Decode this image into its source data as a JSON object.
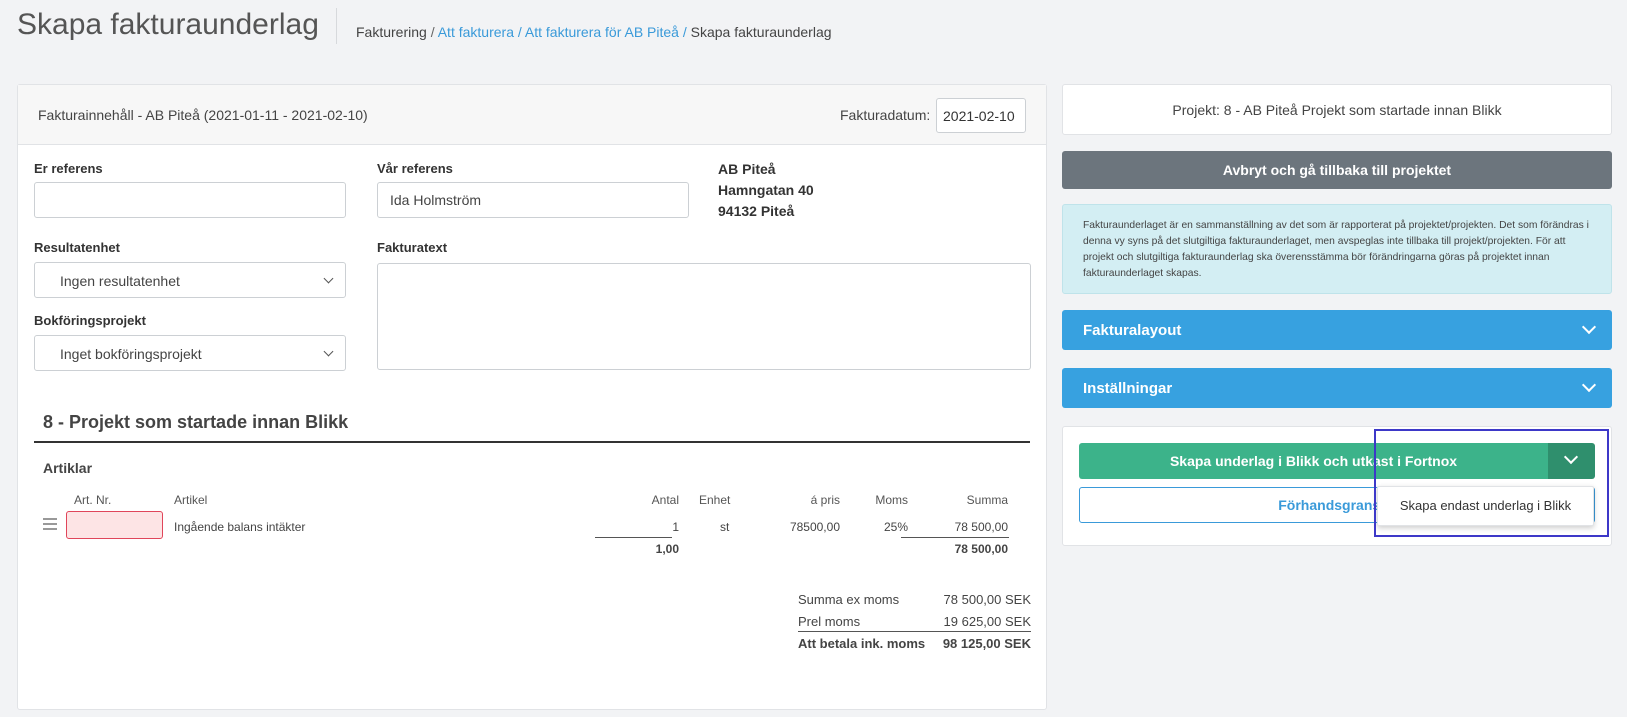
{
  "header": {
    "title": "Skapa fakturaunderlag",
    "breadcrumb": [
      "Fakturering",
      "Att fakturera",
      "Att fakturera för AB Piteå",
      "Skapa fakturaunderlag"
    ],
    "separator": "/"
  },
  "invoice": {
    "content_title": "Fakturainnehåll - AB Piteå (2021-01-11 - 2021-02-10)",
    "date_label": "Fakturadatum:",
    "date_value": "2021-02-10"
  },
  "form": {
    "our_reference_label": "Er referens",
    "our_reference_value": "",
    "your_reference_label": "Vår referens",
    "your_reference_value": "Ida Holmström",
    "result_unit_label": "Resultatenhet",
    "result_unit_value": "Ingen resultatenhet",
    "booking_project_label": "Bokföringsprojekt",
    "booking_project_value": "Inget bokföringsprojekt",
    "invoice_text_label": "Fakturatext",
    "invoice_text_value": ""
  },
  "customer": {
    "name": "AB Piteå",
    "street": "Hamngatan 40",
    "city": "94132 Piteå"
  },
  "project": {
    "title": "8 - Projekt som startade innan Blikk",
    "articles_title": "Artiklar",
    "columns": {
      "art_nr": "Art. Nr.",
      "article": "Artikel",
      "quantity": "Antal",
      "unit": "Enhet",
      "price": "á pris",
      "vat": "Moms",
      "sum": "Summa"
    },
    "rows": [
      {
        "art_nr": "",
        "article": "Ingående balans intäkter",
        "quantity": "1",
        "unit": "st",
        "price": "78500,00",
        "vat": "25%",
        "sum": "78 500,00"
      }
    ],
    "totals_row": {
      "quantity": "1,00",
      "sum": "78 500,00"
    }
  },
  "totals": {
    "ex_vat_label": "Summa ex moms",
    "ex_vat_value": "78 500,00 SEK",
    "vat_label": "Prel moms",
    "vat_value": "19 625,00 SEK",
    "total_label": "Att betala ink. moms",
    "total_value": "98 125,00 SEK"
  },
  "sidebar": {
    "project_label": "Projekt: 8 - AB Piteå Projekt som startade innan Blikk",
    "cancel_button": "Avbryt och gå tillbaka till projektet",
    "info_text": "Fakturaunderlaget är en sammanställning av det som är rapporterat på projektet/projekten. Det som förändras i denna vy syns på det slutgiltiga fakturaunderlaget, men avspeglas inte tillbaka till projekt/projekten. För att projekt och slutgiltiga fakturaunderlag ska överensstämma bör förändringarna göras på projektet innan fakturaunderlaget skapas.",
    "accordion_layout": "Fakturalayout",
    "accordion_settings": "Inställningar",
    "create_button": "Skapa underlag i Blikk och utkast i Fortnox",
    "preview_button": "Förhandsgranska",
    "dropdown_item": "Skapa endast underlag i Blikk"
  },
  "colors": {
    "accent_blue": "#37a1e0",
    "create_green": "#3cb38a",
    "cancel_gray": "#6c757d",
    "info_bg": "#d3eef3",
    "error_red": "#e0455a",
    "highlight": "#3d38c8"
  },
  "icons": [
    "hamburger-icon",
    "chevron-down-icon"
  ]
}
